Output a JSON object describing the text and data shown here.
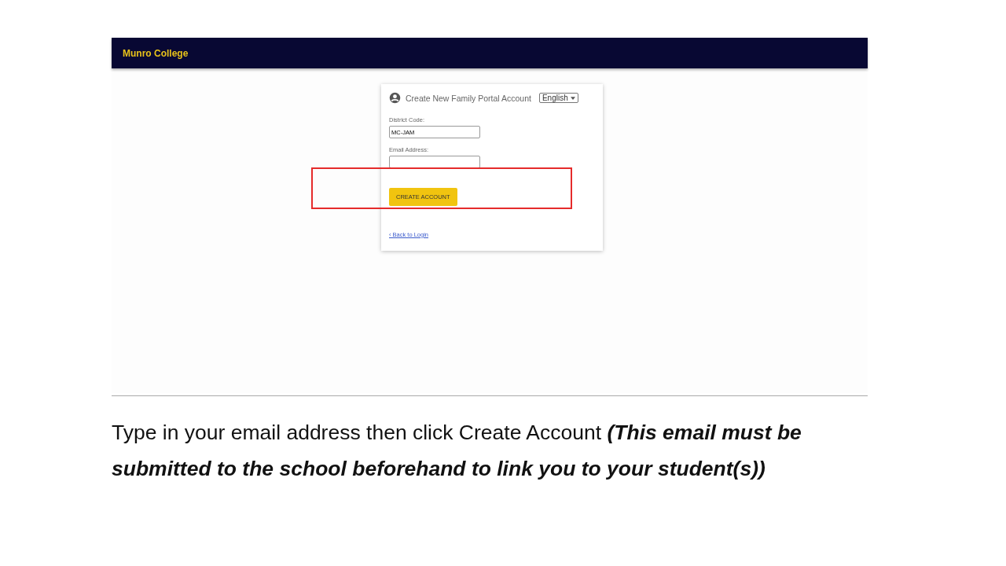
{
  "header": {
    "title": "Munro College"
  },
  "card": {
    "title": "Create New Family Portal Account",
    "language": "English",
    "fields": [
      {
        "label": "District Code:",
        "value": "MC-JAM"
      },
      {
        "label": "Email Address:"
      }
    ],
    "button": "CREATE ACCOUNT",
    "link": "‹ Back to Login"
  },
  "highlight": {
    "kind": "red-box"
  },
  "caption": "Type in your email address then click Create Account **(This email must be submitted to the school beforehand to link you to your student(s))**"
}
